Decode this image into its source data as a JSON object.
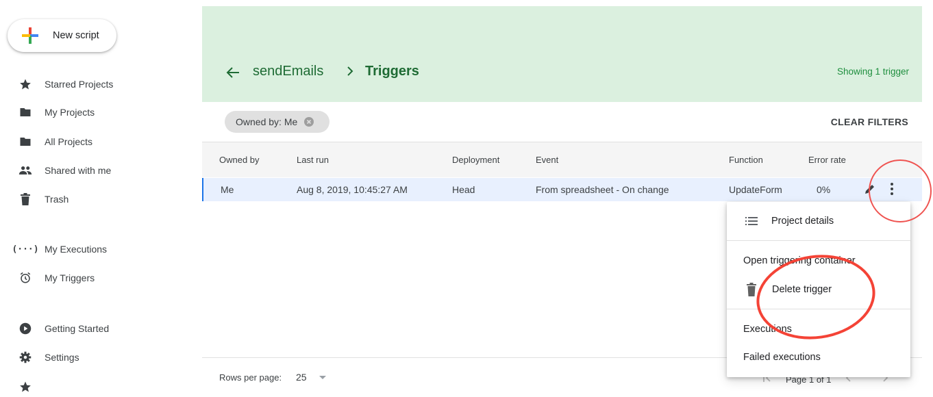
{
  "sidebar": {
    "new_script_label": "New script",
    "items": [
      {
        "label": "Starred Projects",
        "icon": "star-icon"
      },
      {
        "label": "My Projects",
        "icon": "folder-icon"
      },
      {
        "label": "All Projects",
        "icon": "folder-icon"
      },
      {
        "label": "Shared with me",
        "icon": "people-icon"
      },
      {
        "label": "Trash",
        "icon": "trash-icon"
      },
      {
        "label": "My Executions",
        "icon": "executions-icon"
      },
      {
        "label": "My Triggers",
        "icon": "alarm-icon"
      },
      {
        "label": "Getting Started",
        "icon": "play-circle-icon"
      },
      {
        "label": "Settings",
        "icon": "gear-icon"
      }
    ]
  },
  "header": {
    "project_name": "sendEmails",
    "current_page": "Triggers",
    "showing_text": "Showing 1 trigger",
    "background_color": "#dbf0df",
    "accent_color": "#1e6b34"
  },
  "filters": {
    "chip_label": "Owned by: Me",
    "clear_label": "CLEAR FILTERS"
  },
  "table": {
    "columns": [
      "Owned by",
      "Last run",
      "Deployment",
      "Event",
      "Function",
      "Error rate"
    ],
    "rows": [
      {
        "owned_by": "Me",
        "last_run": "Aug 8, 2019, 10:45:27 AM",
        "deployment": "Head",
        "event": "From spreadsheet - On change",
        "function": "UpdateForm",
        "error_rate": "0%"
      }
    ]
  },
  "footer": {
    "rows_per_page_label": "Rows per page:",
    "rows_per_page_value": "25",
    "page_label": "Page 1 of 1"
  },
  "context_menu": {
    "items": [
      {
        "label": "Project details",
        "icon": "list-icon"
      },
      {
        "label": "Open triggering container"
      },
      {
        "label": "Delete trigger",
        "icon": "trash-icon"
      },
      {
        "label": "Executions"
      },
      {
        "label": "Failed executions"
      }
    ]
  },
  "colors": {
    "annotation": "#f44336",
    "selected_row": "#e8f0fe",
    "selected_row_border": "#1a73e8"
  }
}
